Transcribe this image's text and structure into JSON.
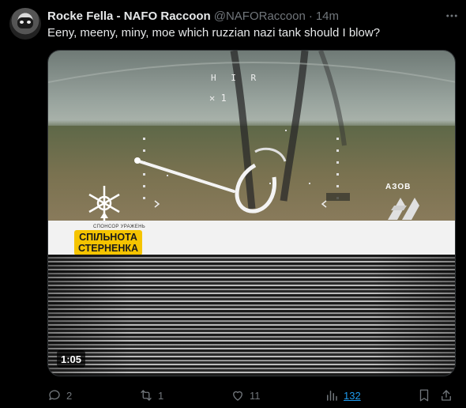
{
  "tweet": {
    "author_name": "Rocke Fella - NAFO Raccoon",
    "author_handle": "@NAFORaccoon",
    "separator": "·",
    "time": "14m",
    "text": "Eeny, meeny, miny, moe which ruzzian nazi tank should I blow?",
    "media": {
      "duration": "1:05",
      "hud_top": "H I R",
      "hud_second": "✕ 1",
      "sponsor_caption": "СПОНСОР УРАЖЕНЬ",
      "sponsor_line1": "СПІЛЬНОТА",
      "sponsor_line2": "СТЕРНЕНКА",
      "azov_label": "АЗОВ"
    },
    "actions": {
      "replies": "2",
      "reposts": "1",
      "likes": "11",
      "views": "132"
    }
  },
  "colors": {
    "background": "#000000",
    "text_primary": "#e7e9ea",
    "text_secondary": "#71767b",
    "link": "#1d9bf0",
    "sponsor_yellow": "#f5c400"
  }
}
